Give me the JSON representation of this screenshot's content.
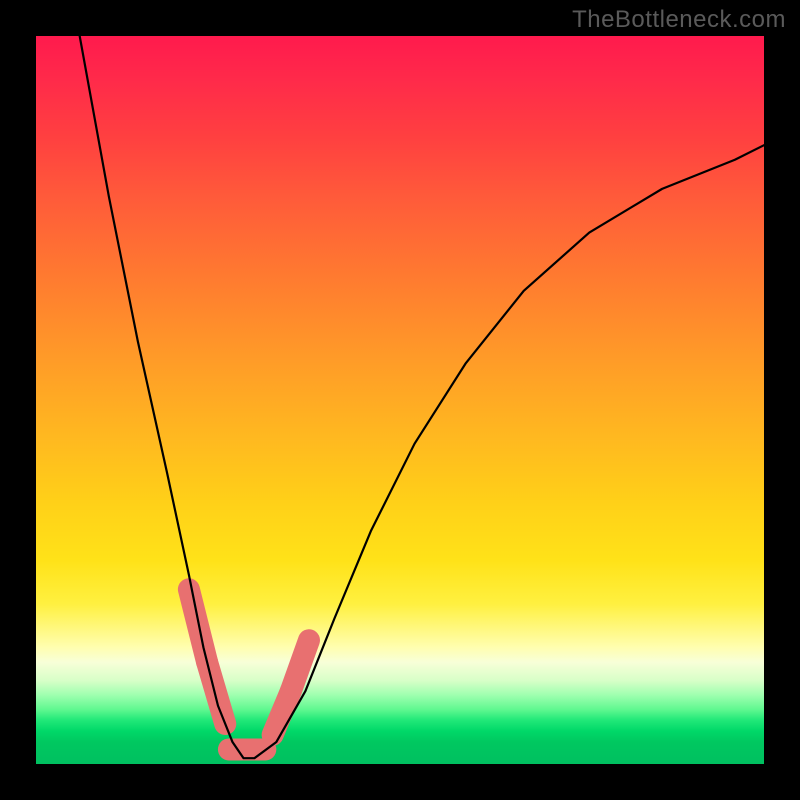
{
  "watermark": "TheBottleneck.com",
  "chart_data": {
    "type": "line",
    "title": "",
    "xlabel": "",
    "ylabel": "",
    "xlim": [
      0,
      100
    ],
    "ylim": [
      0,
      100
    ],
    "grid": false,
    "series": [
      {
        "name": "bottleneck-curve",
        "x": [
          6,
          10,
          14,
          18,
          21,
          23,
          25,
          27,
          28.5,
          30,
          33,
          37,
          41,
          46,
          52,
          59,
          67,
          76,
          86,
          96,
          100
        ],
        "values": [
          100,
          78,
          58,
          40,
          26,
          16,
          8,
          3,
          0.8,
          0.8,
          3,
          10,
          20,
          32,
          44,
          55,
          65,
          73,
          79,
          83,
          85
        ]
      }
    ],
    "markers": [
      {
        "name": "left-descending-band",
        "shape": "rounded-pill",
        "color": "#e87070",
        "segments": [
          {
            "x0": 21.0,
            "y0": 24.0,
            "x1": 23.5,
            "y1": 14.0
          },
          {
            "x0": 23.5,
            "y0": 14.0,
            "x1": 26.0,
            "y1": 5.5
          }
        ]
      },
      {
        "name": "bottom-band",
        "shape": "rounded-pill",
        "color": "#e87070",
        "segments": [
          {
            "x0": 26.5,
            "y0": 2.0,
            "x1": 31.5,
            "y1": 2.0
          }
        ]
      },
      {
        "name": "right-ascending-band",
        "shape": "rounded-pill",
        "color": "#e87070",
        "segments": [
          {
            "x0": 32.5,
            "y0": 4.0,
            "x1": 35.0,
            "y1": 10.0
          },
          {
            "x0": 35.0,
            "y0": 10.0,
            "x1": 37.5,
            "y1": 17.0
          }
        ]
      }
    ],
    "background_gradient": {
      "direction": "top-to-bottom",
      "stops": [
        {
          "pos": 0,
          "color": "#ff1a4d"
        },
        {
          "pos": 0.33,
          "color": "#ff7a30"
        },
        {
          "pos": 0.64,
          "color": "#ffd018"
        },
        {
          "pos": 0.86,
          "color": "#f8ffd8"
        },
        {
          "pos": 1.0,
          "color": "#00c060"
        }
      ]
    }
  }
}
